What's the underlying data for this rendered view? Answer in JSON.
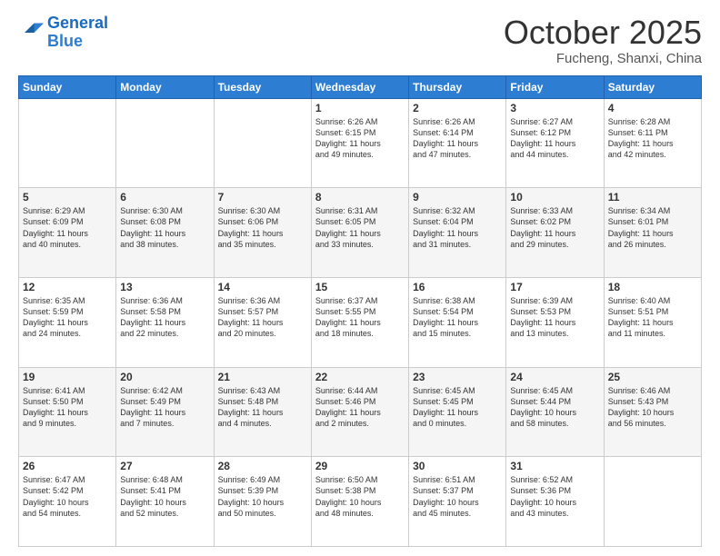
{
  "header": {
    "logo_general": "General",
    "logo_blue": "Blue",
    "month": "October 2025",
    "location": "Fucheng, Shanxi, China"
  },
  "days_of_week": [
    "Sunday",
    "Monday",
    "Tuesday",
    "Wednesday",
    "Thursday",
    "Friday",
    "Saturday"
  ],
  "weeks": [
    [
      {
        "day": "",
        "info": ""
      },
      {
        "day": "",
        "info": ""
      },
      {
        "day": "",
        "info": ""
      },
      {
        "day": "1",
        "info": "Sunrise: 6:26 AM\nSunset: 6:15 PM\nDaylight: 11 hours\nand 49 minutes."
      },
      {
        "day": "2",
        "info": "Sunrise: 6:26 AM\nSunset: 6:14 PM\nDaylight: 11 hours\nand 47 minutes."
      },
      {
        "day": "3",
        "info": "Sunrise: 6:27 AM\nSunset: 6:12 PM\nDaylight: 11 hours\nand 44 minutes."
      },
      {
        "day": "4",
        "info": "Sunrise: 6:28 AM\nSunset: 6:11 PM\nDaylight: 11 hours\nand 42 minutes."
      }
    ],
    [
      {
        "day": "5",
        "info": "Sunrise: 6:29 AM\nSunset: 6:09 PM\nDaylight: 11 hours\nand 40 minutes."
      },
      {
        "day": "6",
        "info": "Sunrise: 6:30 AM\nSunset: 6:08 PM\nDaylight: 11 hours\nand 38 minutes."
      },
      {
        "day": "7",
        "info": "Sunrise: 6:30 AM\nSunset: 6:06 PM\nDaylight: 11 hours\nand 35 minutes."
      },
      {
        "day": "8",
        "info": "Sunrise: 6:31 AM\nSunset: 6:05 PM\nDaylight: 11 hours\nand 33 minutes."
      },
      {
        "day": "9",
        "info": "Sunrise: 6:32 AM\nSunset: 6:04 PM\nDaylight: 11 hours\nand 31 minutes."
      },
      {
        "day": "10",
        "info": "Sunrise: 6:33 AM\nSunset: 6:02 PM\nDaylight: 11 hours\nand 29 minutes."
      },
      {
        "day": "11",
        "info": "Sunrise: 6:34 AM\nSunset: 6:01 PM\nDaylight: 11 hours\nand 26 minutes."
      }
    ],
    [
      {
        "day": "12",
        "info": "Sunrise: 6:35 AM\nSunset: 5:59 PM\nDaylight: 11 hours\nand 24 minutes."
      },
      {
        "day": "13",
        "info": "Sunrise: 6:36 AM\nSunset: 5:58 PM\nDaylight: 11 hours\nand 22 minutes."
      },
      {
        "day": "14",
        "info": "Sunrise: 6:36 AM\nSunset: 5:57 PM\nDaylight: 11 hours\nand 20 minutes."
      },
      {
        "day": "15",
        "info": "Sunrise: 6:37 AM\nSunset: 5:55 PM\nDaylight: 11 hours\nand 18 minutes."
      },
      {
        "day": "16",
        "info": "Sunrise: 6:38 AM\nSunset: 5:54 PM\nDaylight: 11 hours\nand 15 minutes."
      },
      {
        "day": "17",
        "info": "Sunrise: 6:39 AM\nSunset: 5:53 PM\nDaylight: 11 hours\nand 13 minutes."
      },
      {
        "day": "18",
        "info": "Sunrise: 6:40 AM\nSunset: 5:51 PM\nDaylight: 11 hours\nand 11 minutes."
      }
    ],
    [
      {
        "day": "19",
        "info": "Sunrise: 6:41 AM\nSunset: 5:50 PM\nDaylight: 11 hours\nand 9 minutes."
      },
      {
        "day": "20",
        "info": "Sunrise: 6:42 AM\nSunset: 5:49 PM\nDaylight: 11 hours\nand 7 minutes."
      },
      {
        "day": "21",
        "info": "Sunrise: 6:43 AM\nSunset: 5:48 PM\nDaylight: 11 hours\nand 4 minutes."
      },
      {
        "day": "22",
        "info": "Sunrise: 6:44 AM\nSunset: 5:46 PM\nDaylight: 11 hours\nand 2 minutes."
      },
      {
        "day": "23",
        "info": "Sunrise: 6:45 AM\nSunset: 5:45 PM\nDaylight: 11 hours\nand 0 minutes."
      },
      {
        "day": "24",
        "info": "Sunrise: 6:45 AM\nSunset: 5:44 PM\nDaylight: 10 hours\nand 58 minutes."
      },
      {
        "day": "25",
        "info": "Sunrise: 6:46 AM\nSunset: 5:43 PM\nDaylight: 10 hours\nand 56 minutes."
      }
    ],
    [
      {
        "day": "26",
        "info": "Sunrise: 6:47 AM\nSunset: 5:42 PM\nDaylight: 10 hours\nand 54 minutes."
      },
      {
        "day": "27",
        "info": "Sunrise: 6:48 AM\nSunset: 5:41 PM\nDaylight: 10 hours\nand 52 minutes."
      },
      {
        "day": "28",
        "info": "Sunrise: 6:49 AM\nSunset: 5:39 PM\nDaylight: 10 hours\nand 50 minutes."
      },
      {
        "day": "29",
        "info": "Sunrise: 6:50 AM\nSunset: 5:38 PM\nDaylight: 10 hours\nand 48 minutes."
      },
      {
        "day": "30",
        "info": "Sunrise: 6:51 AM\nSunset: 5:37 PM\nDaylight: 10 hours\nand 45 minutes."
      },
      {
        "day": "31",
        "info": "Sunrise: 6:52 AM\nSunset: 5:36 PM\nDaylight: 10 hours\nand 43 minutes."
      },
      {
        "day": "",
        "info": ""
      }
    ]
  ]
}
